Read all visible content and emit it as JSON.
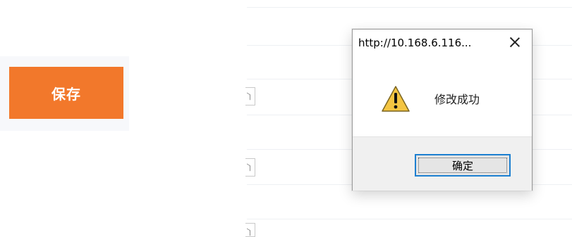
{
  "page": {
    "save_label": "保存"
  },
  "dialog": {
    "title": "http://10.168.6.116...",
    "message": "修改成功",
    "ok_label": "确定"
  },
  "colors": {
    "accent": "#f2782b",
    "focus_border": "#1c7fd0",
    "dialog_footer": "#f0f0f0"
  },
  "icons": {
    "close": "close-icon",
    "warning": "warning-icon"
  }
}
